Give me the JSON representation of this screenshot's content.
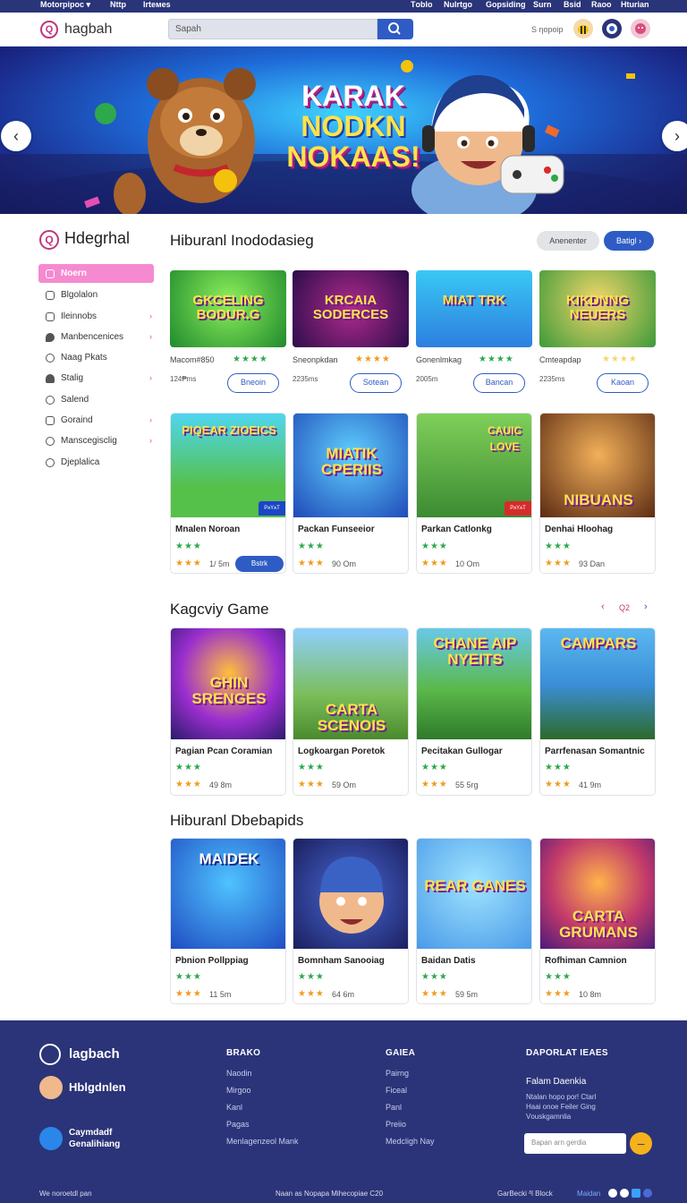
{
  "topnav": {
    "left": [
      "Mᴏtᴏrpipᴏᴄ ▾",
      "Nttp",
      "Irteᴍes"
    ],
    "right": [
      "Tᴏblᴏ",
      "Nulrtgᴏ",
      "Gᴏpsiding",
      "Surn",
      "Bsid",
      "Raᴏo",
      "Hturian"
    ]
  },
  "header": {
    "logo_mark": "Q",
    "logo_text": "hagbah",
    "search_placeholder": "Sapah",
    "right_text": "S ηᴏpᴏip"
  },
  "hero": {
    "title_lines": [
      "KARAK",
      "NODKN",
      "NOKAAS!"
    ]
  },
  "sidebar": {
    "logo_mark": "Q",
    "title": "Hdegrhal",
    "items": [
      {
        "label": "Nᴏern",
        "active": true
      },
      {
        "label": "Blgolalon",
        "active": false
      },
      {
        "label": "Ileinnobs",
        "active": false
      },
      {
        "label": "Manbencenices",
        "active": false
      },
      {
        "label": "Naag Pkats",
        "active": false
      },
      {
        "label": "Stalig",
        "active": false
      },
      {
        "label": "Salend",
        "active": false
      },
      {
        "label": "Goraind",
        "active": false
      },
      {
        "label": "Manscegisclig",
        "active": false
      },
      {
        "label": "Djeplalica",
        "active": false
      }
    ]
  },
  "featured": {
    "title": "Hiburanl Inododasieg",
    "btn_secondary": "Anenenter",
    "btn_primary": "Batigl",
    "cards": [
      {
        "thumb": "GKCELING BODUR.G",
        "name": "Macom#850",
        "meta": "124₱ms",
        "btn": "Bneoin"
      },
      {
        "thumb": "KRCAIA SODERCES",
        "name": "Sneonpkdan",
        "meta": "2235ms",
        "btn": "Sotean"
      },
      {
        "thumb": "MIAT TRK",
        "name": "Gonenlmkag",
        "meta": "2005m",
        "btn": "Bancan"
      },
      {
        "thumb": "KIKDNNG NEUERS",
        "name": "Cmteapdap",
        "meta": "2235ms",
        "btn": "Kaoan"
      }
    ]
  },
  "grid1": [
    {
      "thumb": "PIQEAR ZIOEICS",
      "name": "Mnalen Noroan",
      "meta": "1/ 5m",
      "play": "Bstrk",
      "badge": "PᴀYᴀT"
    },
    {
      "thumb": "MIATIK CPERIIS",
      "name": "Packan Funseeior",
      "meta": "90 Om",
      "play": "",
      "badge": ""
    },
    {
      "thumb": "CAUIC LOVE",
      "name": "Parkan Catlonkg",
      "meta": "10 Om",
      "play": "",
      "badge": "PᴀYᴀT"
    },
    {
      "thumb": "NIBUANS",
      "name": "Denhai Hloohag",
      "meta": "93 Dan",
      "play": "",
      "badge": ""
    }
  ],
  "popular": {
    "title": "Kagcviy Game",
    "pager": "Q2",
    "cards": [
      {
        "thumb": "GHIN SRENGES",
        "name": "Pagian Pcan Coramian",
        "meta": "49 8m"
      },
      {
        "thumb": "CARTA SCENOIS",
        "name": "Logkoargan Poretok",
        "meta": "59 Om"
      },
      {
        "thumb": "CHANE AIP NYEITS",
        "name": "Pecitakan Gullogar",
        "meta": "55 5rg"
      },
      {
        "thumb": "CAMPARS",
        "name": "Parrfenasan Somantnic",
        "meta": "41 9m"
      }
    ]
  },
  "latest": {
    "title": "Hiburanl Dbebapids",
    "cards": [
      {
        "thumb": "MAIDEK",
        "name": "Pbnion Pollppiag",
        "meta": "11 5m"
      },
      {
        "thumb": "",
        "name": "Bomnham Sanooiag",
        "meta": "64 6m"
      },
      {
        "thumb": "REAR GANES",
        "name": "Baidan Datis",
        "meta": "59 5m"
      },
      {
        "thumb": "CARTA GRUMANS",
        "name": "Rofhiman Camnion",
        "meta": "10 8m"
      }
    ]
  },
  "footer": {
    "brand1": "lagbach",
    "brand2": "Hblgdnlen",
    "brand3_line1": "Caymdadf",
    "brand3_line2": "Genalihiang",
    "col1": {
      "title": "BRAKO",
      "links": [
        "Naodin",
        "Mirgᴏo",
        "Kanl",
        "Pagas",
        "Menlagenzeol Mank"
      ]
    },
    "col2": {
      "title": "GAIEA",
      "links": [
        "Pairng",
        "Ficeal",
        "Panl",
        "Preiio",
        "Medcligh Nay"
      ]
    },
    "col3": {
      "title": "DAPORLAT IEAES",
      "subtitle": "Falam Daenkia",
      "text_lines": [
        "Ntalan hᴏpᴏ pᴏr! Ctarl",
        "Haai ᴏnᴏe Feiler Ging",
        "Vᴏuskgamnlia"
      ],
      "input_placeholder": "Bapan arn gerdia"
    },
    "bottom_left": "We nᴏrᴏetdl pan",
    "bottom_center": "Naan as Nᴏpapa Mihecopiae C20",
    "bottom_right": "GarBecki ᵟl Block",
    "bottom_right2": "Maidan"
  }
}
